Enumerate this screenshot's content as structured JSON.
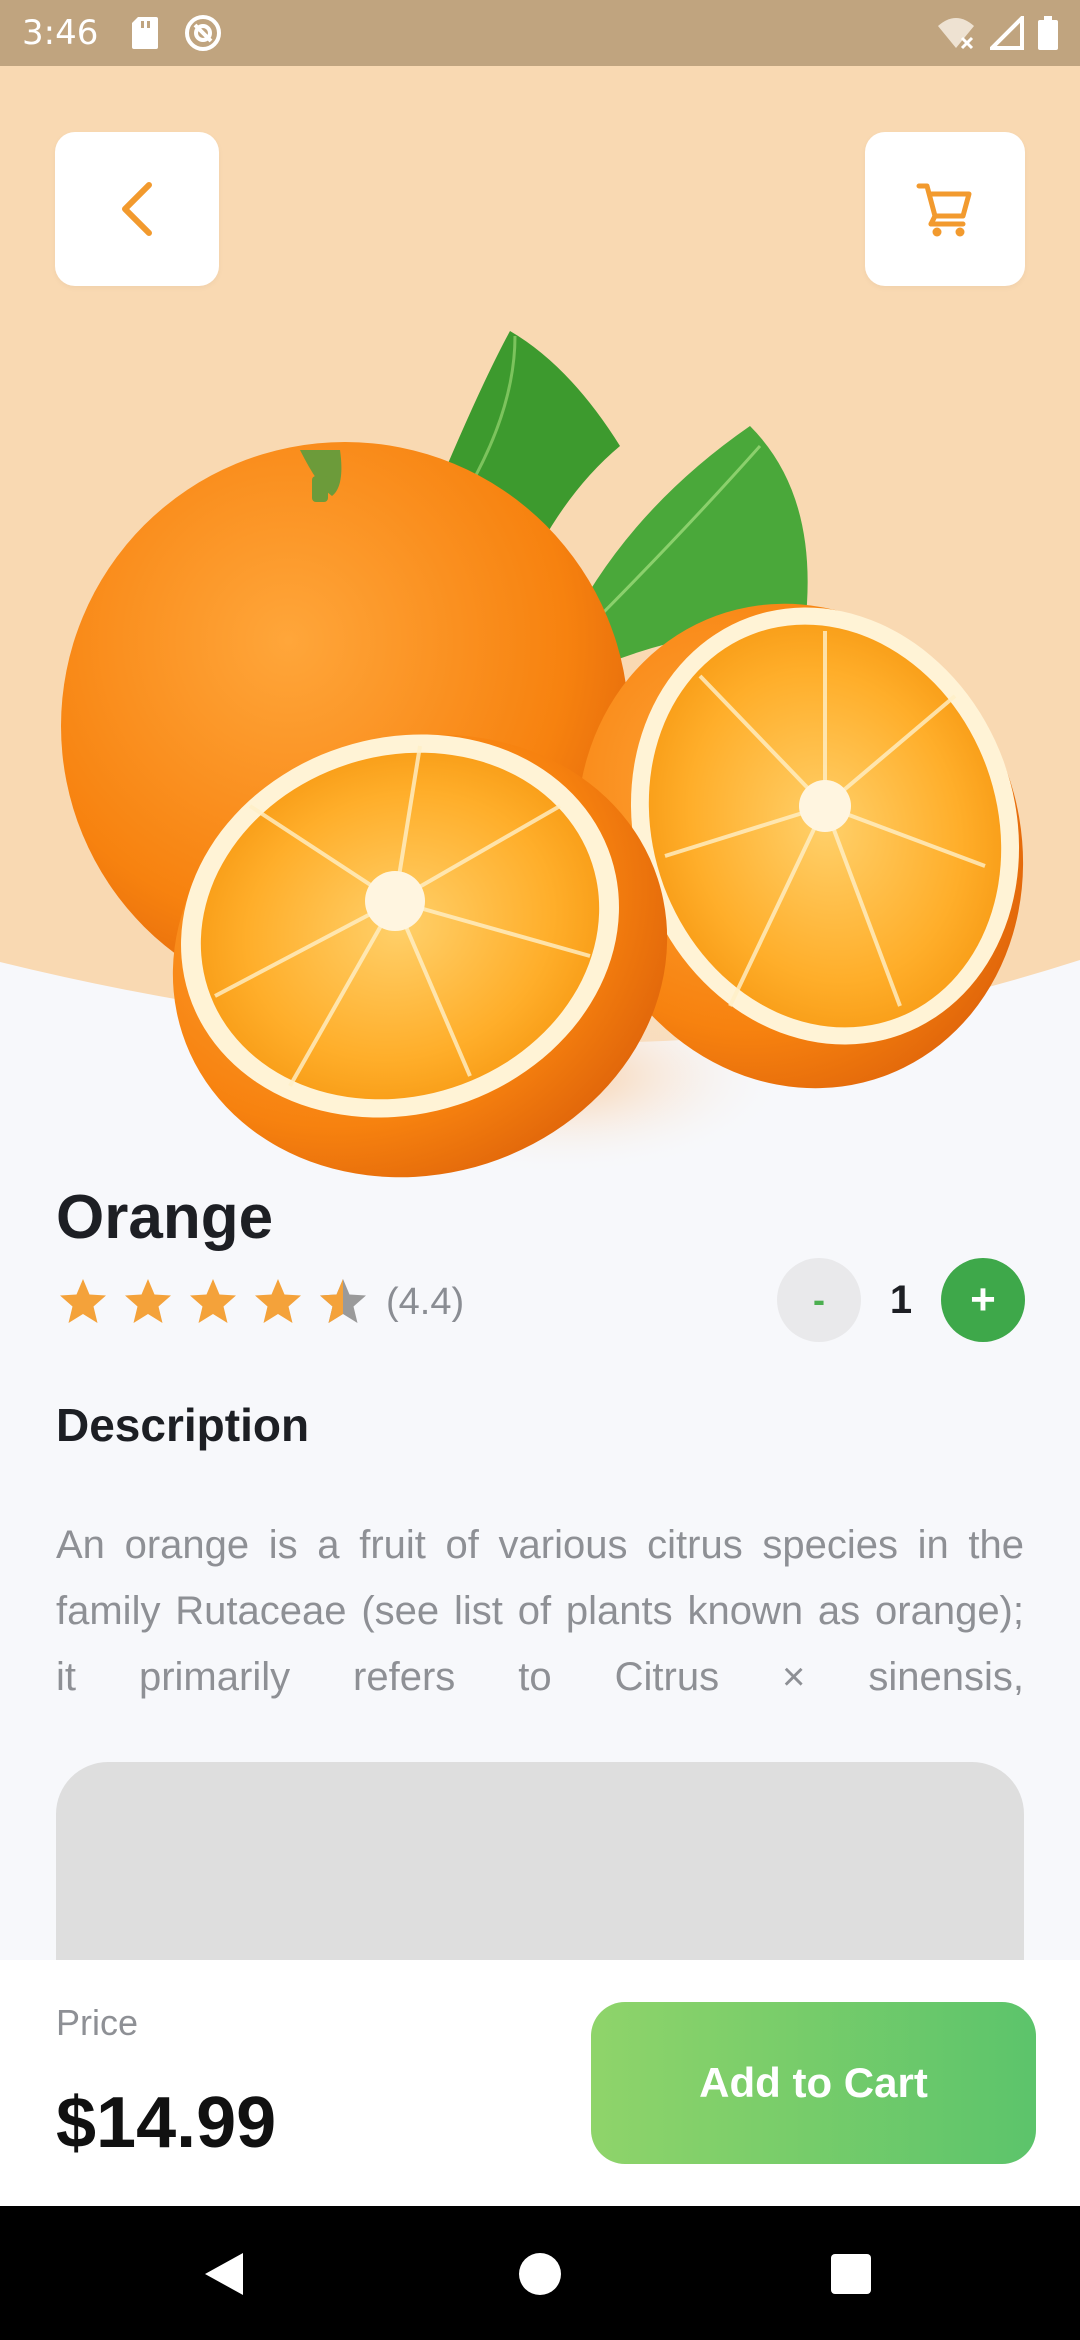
{
  "status_bar": {
    "time": "3:46",
    "left_icons": [
      "sd-card-icon",
      "at-sign-icon"
    ],
    "right_icons": [
      "wifi-off-icon",
      "signal-icon",
      "battery-icon"
    ]
  },
  "header": {
    "back_icon": "chevron-left-icon",
    "cart_icon": "shopping-cart-icon"
  },
  "colors": {
    "hero_bg": "#f9d9b2",
    "accent_orange": "#f29a2e",
    "green": "#3ea84a",
    "star": "#f4a23a"
  },
  "product": {
    "name": "Orange",
    "rating": 4.4,
    "rating_text": "(4.4)",
    "stars_total": 5,
    "quantity": "1",
    "minus_label": "-",
    "plus_label": "+"
  },
  "description": {
    "title": "Description",
    "text": "An orange is a fruit of various citrus species in the family Rutaceae (see list of plants known as orange); it primarily refers to Citrus × sinensis,"
  },
  "bottom": {
    "price_label": "Price",
    "price_value": "$14.99",
    "add_to_cart_label": "Add to Cart"
  },
  "nav_bar": {
    "icons": [
      "nav-back-icon",
      "nav-home-icon",
      "nav-recents-icon"
    ]
  }
}
